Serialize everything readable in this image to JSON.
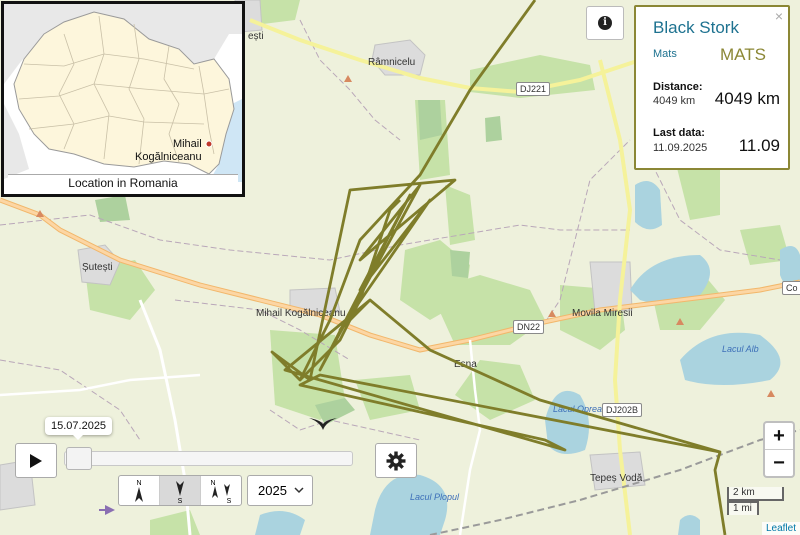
{
  "map": {
    "places": [
      {
        "name": "Râmnicelu"
      },
      {
        "name": "Șutești"
      },
      {
        "name": "Mihail Kogălniceanu"
      },
      {
        "name": "Movila Miresii"
      },
      {
        "name": "Esna"
      },
      {
        "name": "Tepeș Vodă"
      },
      {
        "name": "ești"
      }
    ],
    "roads": [
      "DJ221",
      "DN22",
      "DJ202B",
      "Co"
    ],
    "lakes": [
      {
        "name": "Lacul Alb"
      },
      {
        "name": "Lacul Opreanu"
      },
      {
        "name": "Lacul Plopul"
      }
    ],
    "track_color": "#7f7d2a"
  },
  "inset": {
    "caption": "Location in Romania",
    "marker_label_line1": "Mihail",
    "marker_label_line2": "Kogălniceanu",
    "marker_color": "#c0392b"
  },
  "card": {
    "title": "Black Stork",
    "subtitle": "Mats",
    "name": "MATS",
    "close": "×",
    "distance_label": "Distance:",
    "distance_small": "4049 km",
    "distance_big": "4049 km",
    "last_label": "Last data:",
    "last_small": "11.09.2025",
    "last_big": "11.09"
  },
  "controls": {
    "date_tip": "15.07.2025",
    "slider_position": 0.0,
    "year": "2025",
    "directions": [
      {
        "letters": [
          "N"
        ]
      },
      {
        "letters": [
          "S"
        ]
      },
      {
        "letters": [
          "N",
          "S"
        ]
      }
    ],
    "active_direction": 1
  },
  "zoom": {
    "in": "+",
    "out": "−"
  },
  "scale": {
    "km": "2 km",
    "mi": "1 mi"
  },
  "attribution": "Leaflet",
  "info_icon": "i"
}
